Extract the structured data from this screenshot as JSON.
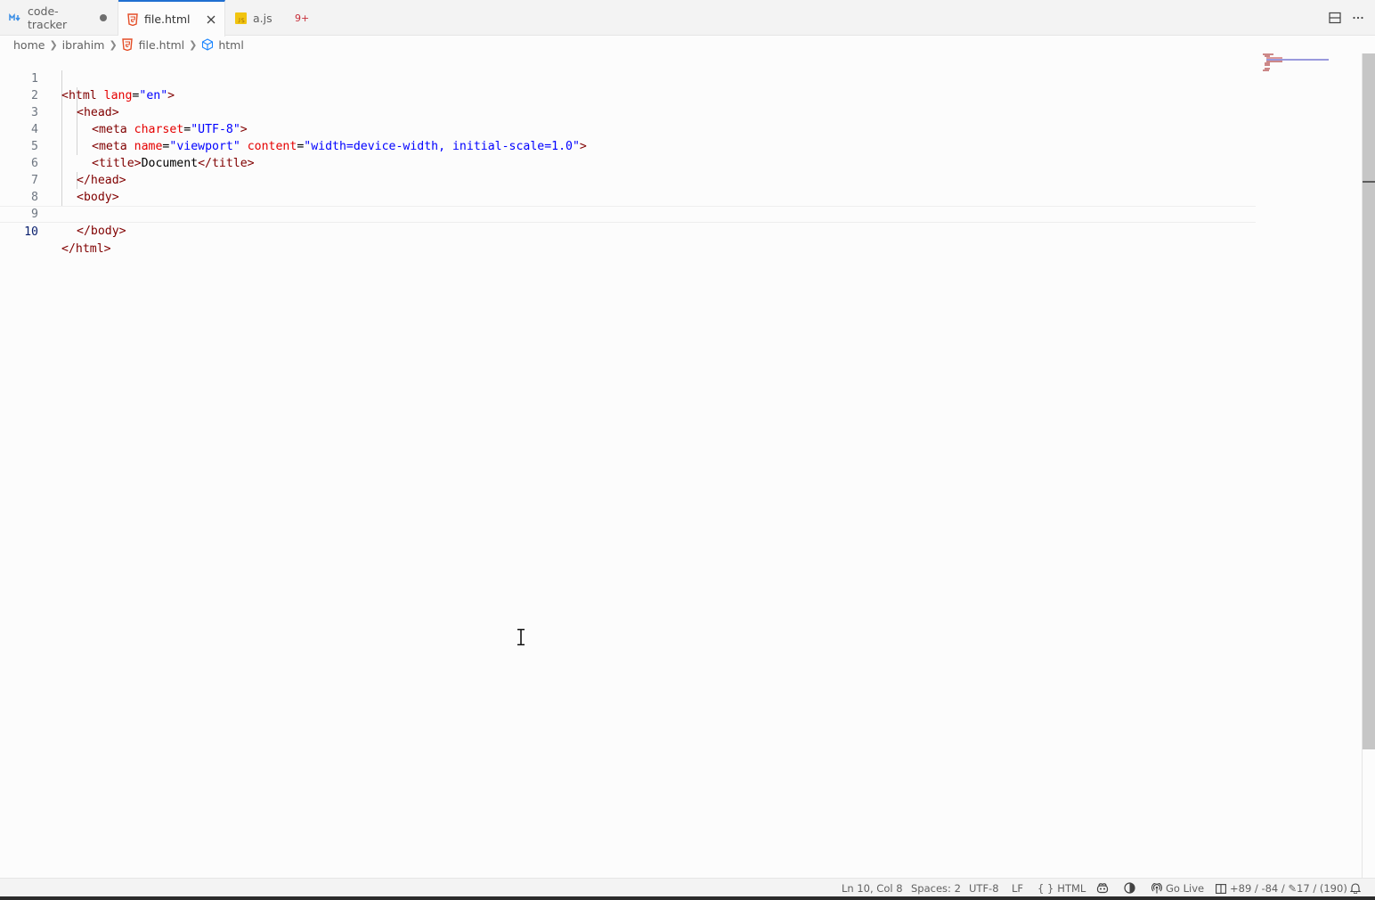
{
  "tabs": [
    {
      "label": "code-tracker",
      "icon": "markdown-icon",
      "modified": true
    },
    {
      "label": "file.html",
      "icon": "html5-icon",
      "active": true
    },
    {
      "label": "a.js",
      "icon": "js-icon"
    }
  ],
  "problems_count": "9+",
  "breadcrumb": [
    "home",
    "ibrahim",
    "file.html",
    "html"
  ],
  "code_lines": [
    {
      "n": "1"
    },
    {
      "n": "2"
    },
    {
      "n": "3"
    },
    {
      "n": "4"
    },
    {
      "n": "5"
    },
    {
      "n": "6"
    },
    {
      "n": "7"
    },
    {
      "n": "8"
    },
    {
      "n": "9"
    },
    {
      "n": "10"
    }
  ],
  "code": {
    "l1": [
      "<html",
      " ",
      "lang",
      "=",
      "\"en\"",
      ">"
    ],
    "l2": [
      "<head>"
    ],
    "l3": [
      "<meta",
      " ",
      "charset",
      "=",
      "\"UTF-8\"",
      ">"
    ],
    "l4": [
      "<meta",
      " ",
      "name",
      "=",
      "\"viewport\"",
      " ",
      "content",
      "=",
      "\"width=device-width, initial-scale=1.0\"",
      ">"
    ],
    "l5": [
      "<title>",
      "Document",
      "</title>"
    ],
    "l6": [
      "</head>"
    ],
    "l7": [
      "<body>"
    ],
    "l9": [
      "</body>"
    ],
    "l10": [
      "</html>"
    ]
  },
  "status": {
    "position": "Ln 10, Col 8",
    "spaces": "Spaces: 2",
    "encoding": "UTF-8",
    "eol": "LF",
    "language": "HTML",
    "language_icon": "{ }",
    "go_live": "Go Live",
    "git_stats": "+89 / -84 / ✎17 / (190)"
  },
  "colors": {
    "tag": "#800000",
    "attribute": "#e50000",
    "string": "#0000ff",
    "active_tab_border": "#1f6fd1"
  }
}
